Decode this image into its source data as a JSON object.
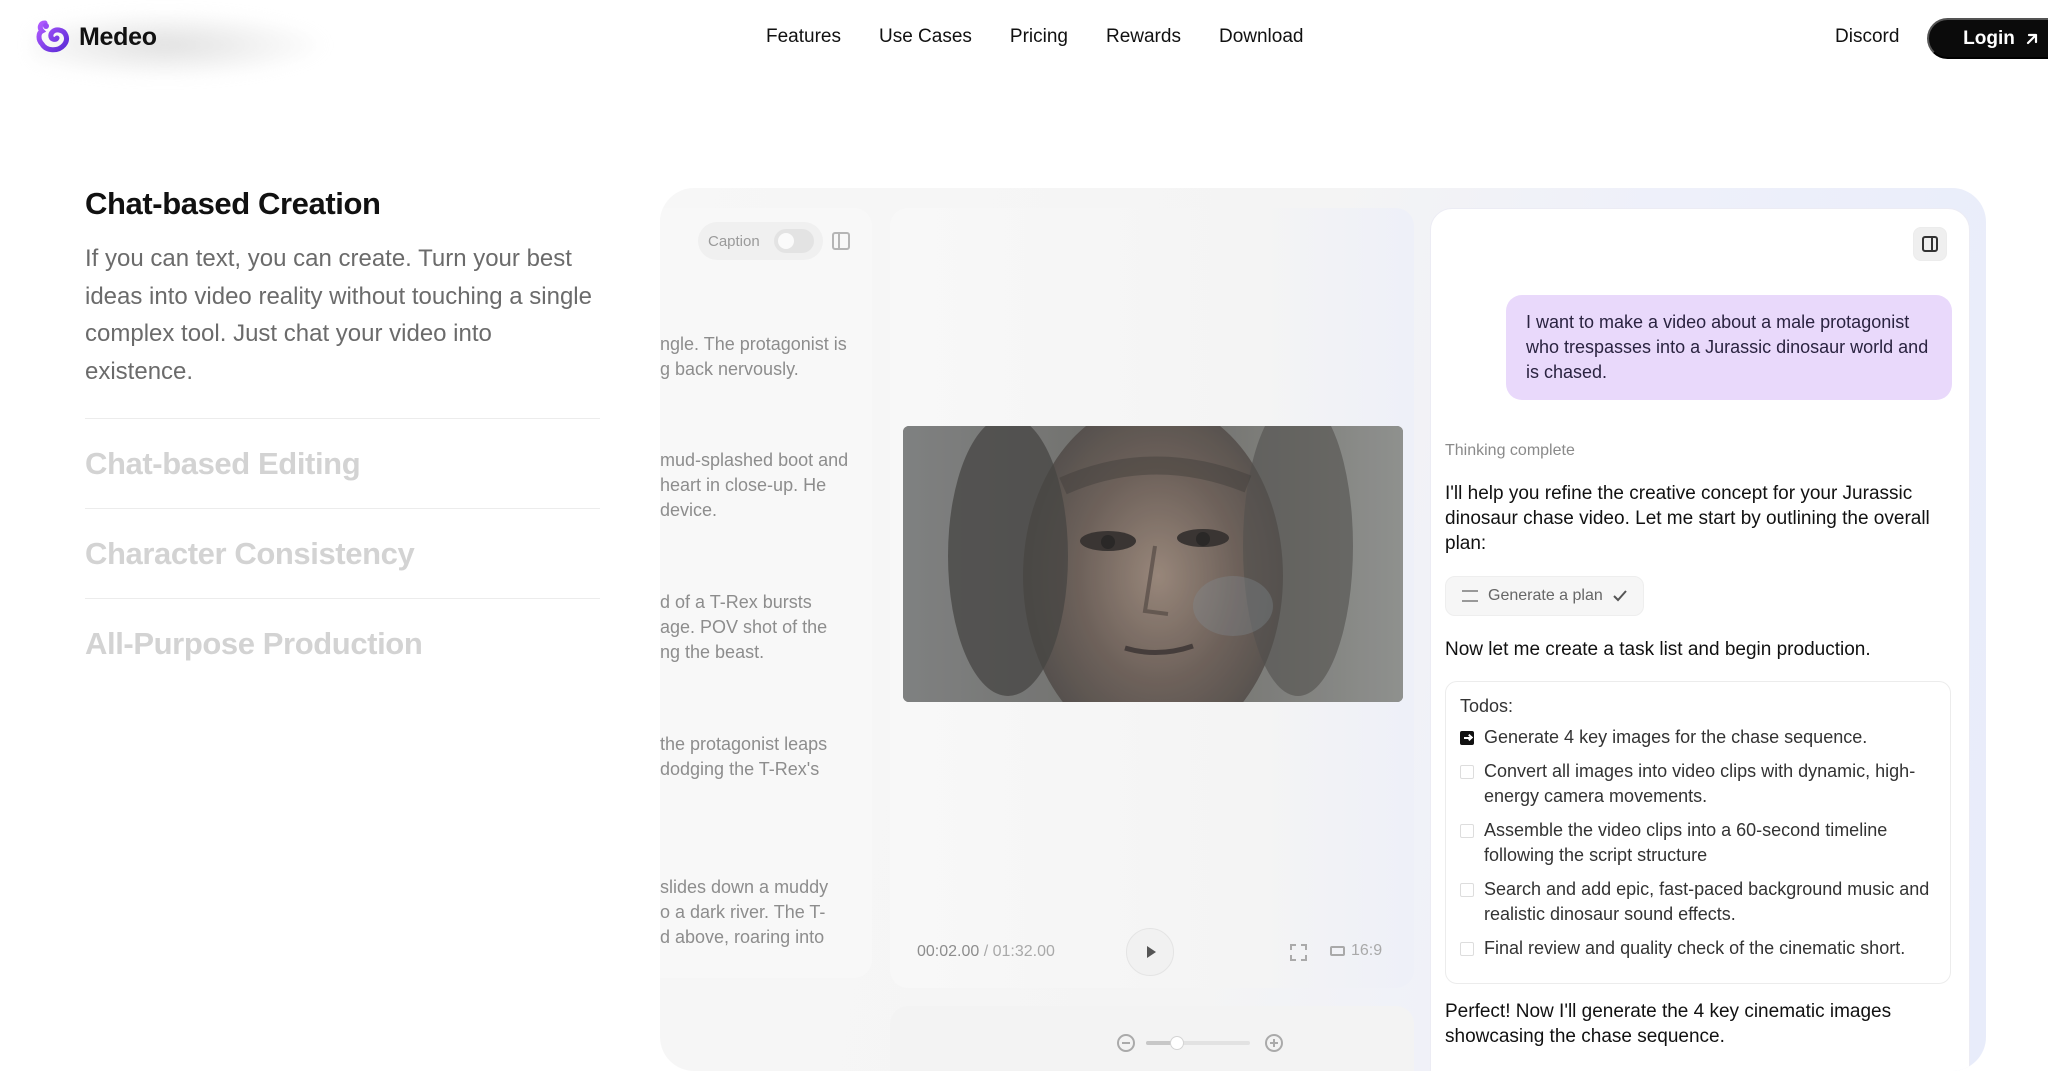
{
  "nav": {
    "brand": "Medeo",
    "links": [
      "Features",
      "Use Cases",
      "Pricing",
      "Rewards",
      "Download"
    ],
    "discord": "Discord",
    "login": "Login"
  },
  "features": {
    "active_title": "Chat-based Creation",
    "active_description": "If you can text, you can create. Turn your best ideas into video reality without touching a single complex tool. Just chat your video into existence.",
    "others": [
      "Chat-based Editing",
      "Character Consistency",
      "All-Purpose Production"
    ]
  },
  "script_panel": {
    "caption_label": "Caption",
    "paragraphs": [
      [
        "ngle. The protagonist is",
        "g back nervously."
      ],
      [
        "mud-splashed boot and",
        " heart in close-up. He",
        "device."
      ],
      [
        "d of a T-Rex bursts",
        "age. POV shot of the",
        "ng the beast."
      ],
      [
        " the protagonist leaps",
        " dodging the T-Rex's"
      ],
      [
        " slides down a muddy",
        "o a dark river. The T-",
        "d above, roaring into"
      ]
    ]
  },
  "player": {
    "current_time": "00:02.00",
    "separator": " / ",
    "total_time": "01:32.00",
    "aspect_ratio": "16:9"
  },
  "timeline": {
    "zoom_level": 0.3
  },
  "chat": {
    "user_message": "I want to make a video about a male protagonist who trespasses into a Jurassic dinosaur world and is chased.",
    "thinking_status": "Thinking complete",
    "reply_intro": "I'll help you refine the creative concept for your Jurassic dinosaur chase video. Let me start by outlining the overall plan:",
    "plan_chip": "Generate a plan",
    "reply_tasks": "Now let me create a task list and begin production.",
    "todos_title": "Todos:",
    "todos": [
      {
        "text": "Generate 4 key images for the chase sequence.",
        "done": true
      },
      {
        "text": "Convert all images into video clips with dynamic, high-energy camera movements.",
        "done": false
      },
      {
        "text": "Assemble the video clips into a 60-second timeline following the script structure",
        "done": false
      },
      {
        "text": "Search and add epic, fast-paced background music and realistic dinosaur sound effects.",
        "done": false
      },
      {
        "text": "Final review and quality check of the cinematic short.",
        "done": false
      }
    ],
    "reply_final": "Perfect! Now I'll generate the 4 key cinematic images showcasing the chase sequence."
  },
  "colors": {
    "login_bg": "#0b0b0b",
    "user_bubble": "#e9d9fb",
    "brand_accent": "#7a3df2"
  }
}
